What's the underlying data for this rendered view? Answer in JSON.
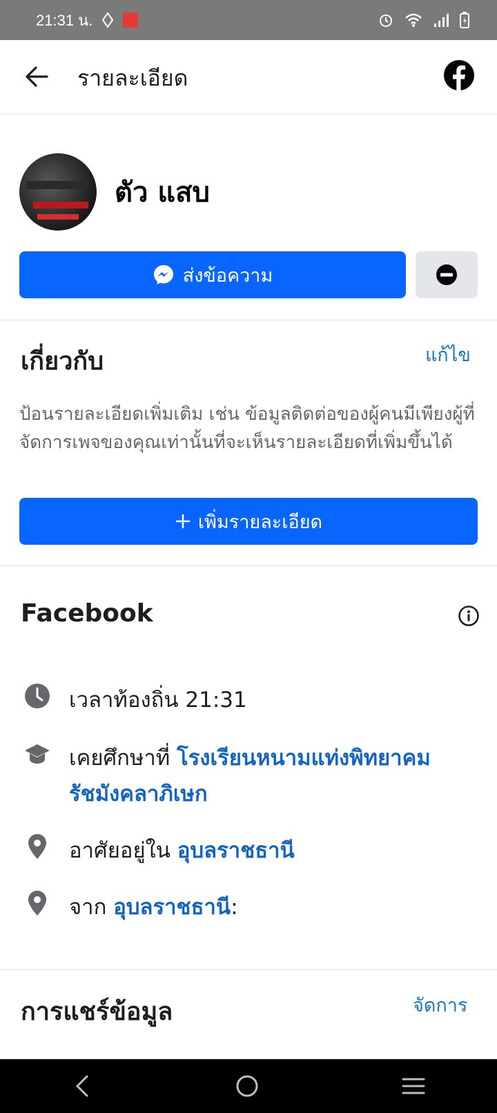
{
  "status_bar": {
    "time": "21:31 น.",
    "icons": [
      "diamond-icon",
      "app-badge-icon",
      "alarm-icon",
      "wifi-icon",
      "signal-icon",
      "battery-icon"
    ]
  },
  "app_bar": {
    "title": "รายละเอียด",
    "back_icon": "arrow-left-icon",
    "brand_icon": "facebook-icon"
  },
  "profile": {
    "name": "ตัว แสบ"
  },
  "actions": {
    "message_label": "ส่งข้อความ",
    "block_icon": "block-icon"
  },
  "about": {
    "title": "เกี่ยวกับ",
    "edit_label": "แก้ไข",
    "description": "ป้อนรายละเอียดเพิ่มเติม เช่น ข้อมูลติดต่อของผู้คนมีเพียงผู้ที่จัดการเพจของคุณเท่านั้นที่จะเห็นรายละเอียดที่เพิ่มขึ้นได้",
    "add_details_label": "เพิ่มรายละเอียด"
  },
  "facebook_section": {
    "title": "Facebook",
    "items": [
      {
        "icon": "clock-icon",
        "text": "เวลาท้องถิ่น 21:31",
        "link": ""
      },
      {
        "icon": "graduation-cap-icon",
        "text": "เคยศึกษาที่ ",
        "link": "โรงเรียนหนามแท่งพิทยาคม รัชมังคลาภิเษก"
      },
      {
        "icon": "location-pin-icon",
        "text": "อาศัยอยู่ใน ",
        "link": "อุบลราชธานี"
      },
      {
        "icon": "location-pin-icon",
        "text": "จาก ",
        "link": "อุบลราชธานี",
        "suffix": ":"
      }
    ]
  },
  "sharing": {
    "title": "การแชร์ข้อมูล",
    "manage_label": "จัดการ"
  },
  "colors": {
    "primary": "#0866ff",
    "link": "#1465c2",
    "status_bar": "#7a7a7a"
  }
}
